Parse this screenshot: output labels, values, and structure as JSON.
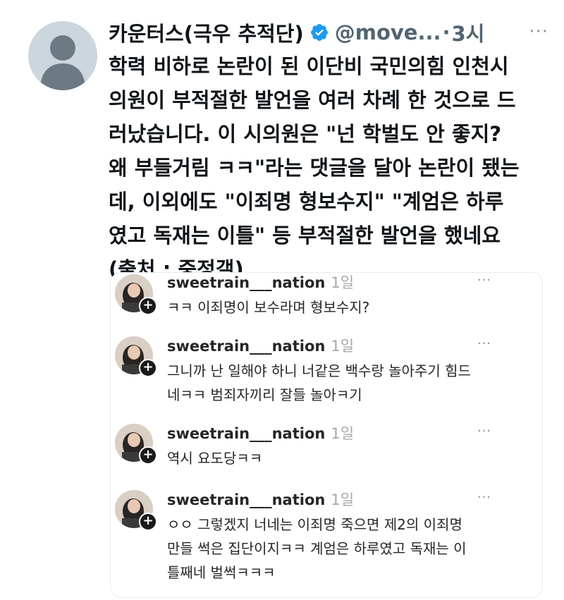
{
  "tweet": {
    "display_name": "카운터스(극우 추적단)",
    "handle": "@move...",
    "separator": "·",
    "time": "3시",
    "more": "···",
    "text_lines": [
      "학력 비하로 논란이 된 이단비 국민의힘 인천시",
      "의원이 부적절한 발언을 여러 차례 한 것으로 드",
      "러났습니다. 이 시의원은 \"넌 학벌도 안 좋지?",
      "왜 부들거림 ㅋㅋ\"라는 댓글을 달아 논란이 됐는",
      "데, 이외에도 \"이죄명 형보수지\" \"계엄은 하루",
      "였고 독재는 이틀\" 등 부적절한 발언을 했네요",
      "(출처 : 중정갤)"
    ]
  },
  "comments": [
    {
      "username": "sweetrain___nation",
      "time": "1일",
      "more": "···",
      "lines": [
        "ㅋㅋ 이죄명이 보수라며 형보수지?"
      ]
    },
    {
      "username": "sweetrain___nation",
      "time": "1일",
      "more": "···",
      "lines": [
        "그니까 난 일해야 하니 너같은 백수랑 놀아주기 힘드",
        "네ㅋㅋ 범죄자끼리 잘들 놀아ㅋ기"
      ]
    },
    {
      "username": "sweetrain___nation",
      "time": "1일",
      "more": "···",
      "lines": [
        "역시 요도당ㅋㅋ"
      ]
    },
    {
      "username": "sweetrain___nation",
      "time": "1일",
      "more": "···",
      "lines": [
        "ㅇㅇ 그렇겠지 너네는 이죄명 죽으면 제2의 이죄명",
        "만들 썩은 집단이지ㅋㅋ 계엄은 하루였고 독재는 이",
        "틀째네 벌썩ㅋㅋㅋ"
      ]
    }
  ],
  "colors": {
    "verified": "#1d9bf0",
    "text": "#0f1419",
    "muted": "#536471"
  }
}
